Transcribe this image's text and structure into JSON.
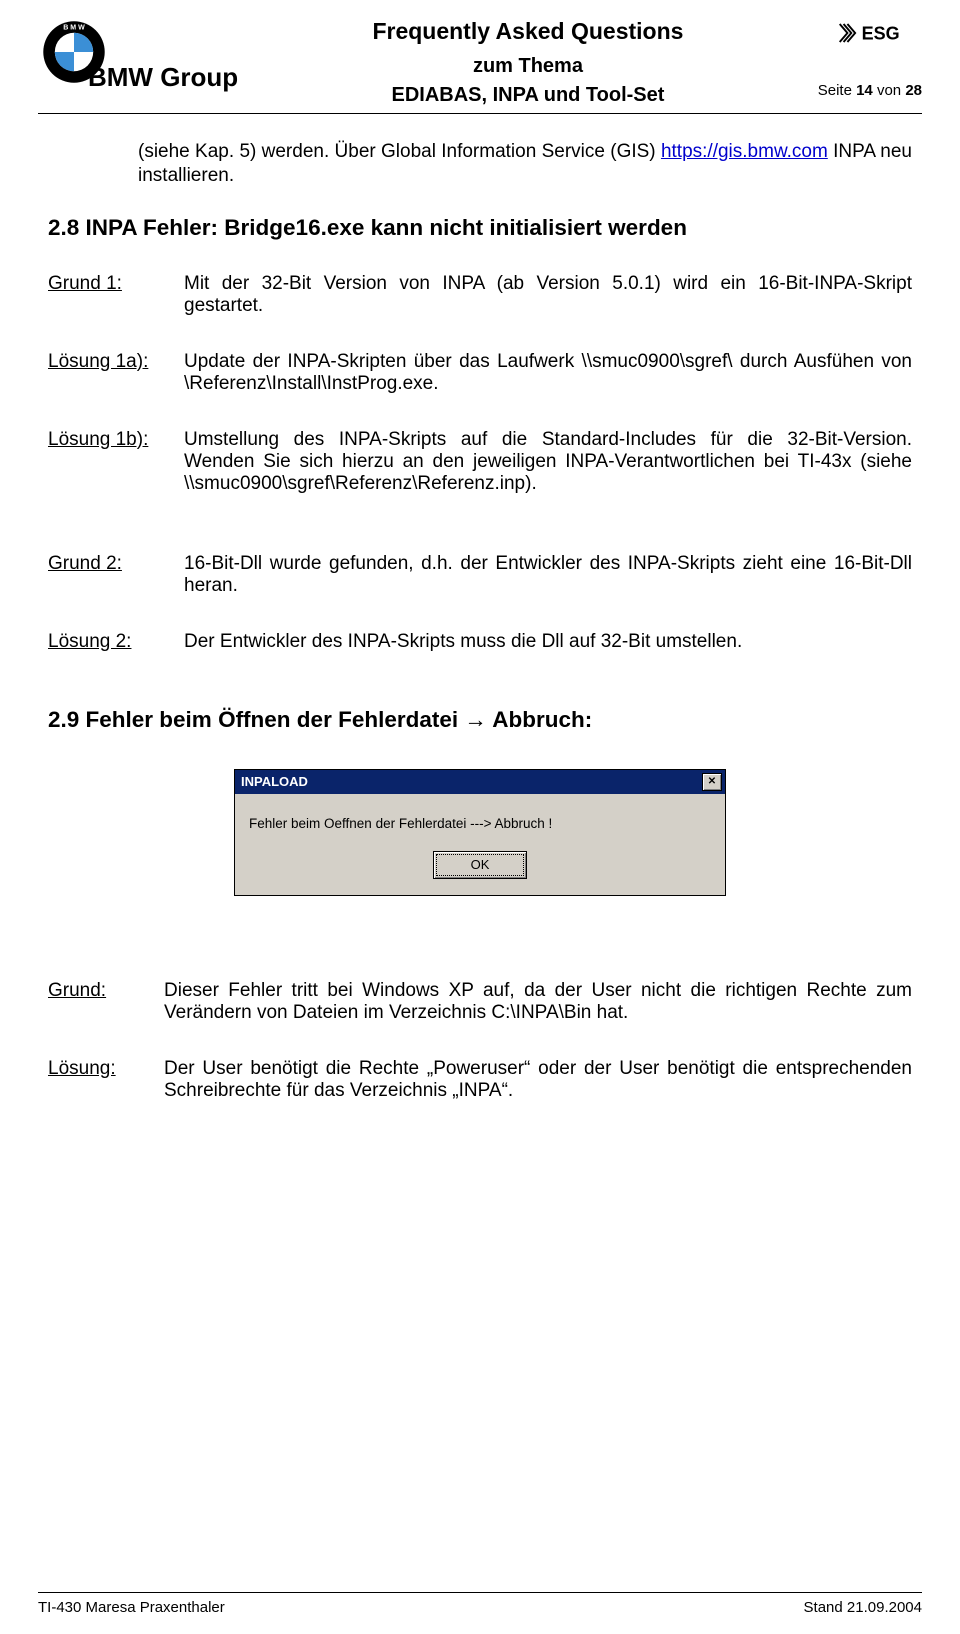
{
  "header": {
    "company": "BMW Group",
    "title1": "Frequently Asked Questions",
    "title2": "zum Thema",
    "title3": "EDIABAS, INPA und Tool-Set",
    "page_prefix": "Seite ",
    "page_current": "14",
    "page_of": " von ",
    "page_total": "28",
    "esg_text": "ESG"
  },
  "intro": {
    "text_a": "(siehe   Kap.   5)   werden.   Über   Global   Information   Service   (GIS) ",
    "link": "https://gis.bmw.com",
    "text_b": " INPA neu installieren."
  },
  "sec2_8": {
    "heading": "2.8  INPA Fehler: Bridge16.exe kann nicht initialisiert werden",
    "rows": {
      "g1_lbl": "Grund 1:",
      "g1_val": "Mit der 32-Bit Version von INPA (ab Version 5.0.1) wird ein 16-Bit-INPA-Skript gestartet.",
      "l1a_lbl": "Lösung 1a):",
      "l1a_val": "Update der INPA-Skripten über das Laufwerk \\\\smuc0900\\sgref\\ durch Ausfühen von \\Referenz\\Install\\InstProg.exe.",
      "l1b_lbl": "Lösung 1b):",
      "l1b_val": "Umstellung des INPA-Skripts auf die Standard-Includes für die 32-Bit-Version. Wenden Sie sich hierzu an den jeweiligen INPA-Verantwortlichen bei TI-43x (siehe \\\\smuc0900\\sgref\\Referenz\\Referenz.inp).",
      "g2_lbl": "Grund 2:",
      "g2_val": "16-Bit-Dll wurde gefunden, d.h. der Entwickler des INPA-Skripts zieht eine 16-Bit-Dll heran.",
      "l2_lbl": "Lösung 2:",
      "l2_val": "Der Entwickler des INPA-Skripts muss die Dll auf 32-Bit umstellen."
    }
  },
  "sec2_9": {
    "heading": "2.9  Fehler beim Öffnen der Fehlerdatei → Abbruch:",
    "dialog": {
      "title": "INPALOAD",
      "message": "Fehler beim Oeffnen der Fehlerdatei ---> Abbruch !",
      "ok": "OK",
      "close_glyph": "✕"
    },
    "rows": {
      "g_lbl": "Grund:",
      "g_val": "Dieser Fehler tritt bei Windows XP auf, da der User nicht die richtigen Rechte zum Verändern von Dateien im Verzeichnis C:\\INPA\\Bin hat.",
      "l_lbl": "Lösung:",
      "l_val": "Der User benötigt die Rechte „Poweruser“ oder der User benötigt die entsprechenden Schreibrechte für das Verzeichnis „INPA“."
    }
  },
  "footer": {
    "left": "TI-430    Maresa Praxenthaler",
    "right": "Stand 21.09.2004"
  }
}
